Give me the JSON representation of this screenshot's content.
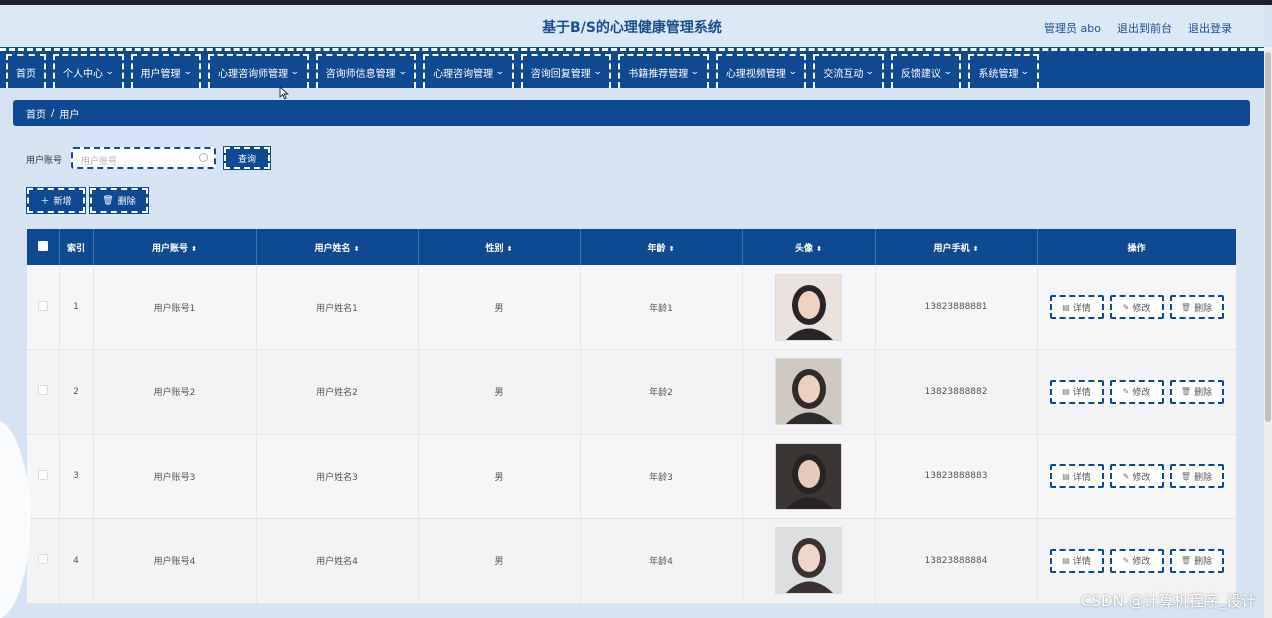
{
  "header": {
    "title": "基于B/S的心理健康管理系统",
    "admin_label": "管理员 abo",
    "back_to_front": "退出到前台",
    "logout": "退出登录"
  },
  "nav": {
    "items": [
      {
        "label": "首页",
        "has_dropdown": false
      },
      {
        "label": "个人中心",
        "has_dropdown": true
      },
      {
        "label": "用户管理",
        "has_dropdown": true
      },
      {
        "label": "心理咨询师管理",
        "has_dropdown": true
      },
      {
        "label": "咨询师信息管理",
        "has_dropdown": true
      },
      {
        "label": "心理咨询管理",
        "has_dropdown": true
      },
      {
        "label": "咨询回复管理",
        "has_dropdown": true
      },
      {
        "label": "书籍推荐管理",
        "has_dropdown": true
      },
      {
        "label": "心理视频管理",
        "has_dropdown": true
      },
      {
        "label": "交流互动",
        "has_dropdown": true
      },
      {
        "label": "反馈建议",
        "has_dropdown": true
      },
      {
        "label": "系统管理",
        "has_dropdown": true
      }
    ]
  },
  "breadcrumb": {
    "home": "首页",
    "sep": "/",
    "current": "用户"
  },
  "search": {
    "label": "用户账号",
    "placeholder": "用户账号",
    "value": "",
    "button": "查询"
  },
  "actions": {
    "add": "新增",
    "delete": "删除"
  },
  "table": {
    "columns": [
      "索引",
      "用户账号",
      "用户姓名",
      "性别",
      "年龄",
      "头像",
      "用户手机",
      "操作"
    ],
    "rows": [
      {
        "index": "1",
        "account": "用户账号1",
        "name": "用户姓名1",
        "gender": "男",
        "age": "年龄1",
        "phone": "13823888881"
      },
      {
        "index": "2",
        "account": "用户账号2",
        "name": "用户姓名2",
        "gender": "男",
        "age": "年龄2",
        "phone": "13823888882"
      },
      {
        "index": "3",
        "account": "用户账号3",
        "name": "用户姓名3",
        "gender": "男",
        "age": "年龄3",
        "phone": "13823888883"
      },
      {
        "index": "4",
        "account": "用户账号4",
        "name": "用户姓名4",
        "gender": "男",
        "age": "年龄4",
        "phone": "13823888884"
      }
    ],
    "row_actions": {
      "detail": "详情",
      "edit": "修改",
      "delete": "删除"
    }
  },
  "watermark": "CSDN @计算机程序_设计",
  "colors": {
    "primary": "#0d4a92",
    "background": "#d5e3f2",
    "title": "#1d4f8c"
  }
}
